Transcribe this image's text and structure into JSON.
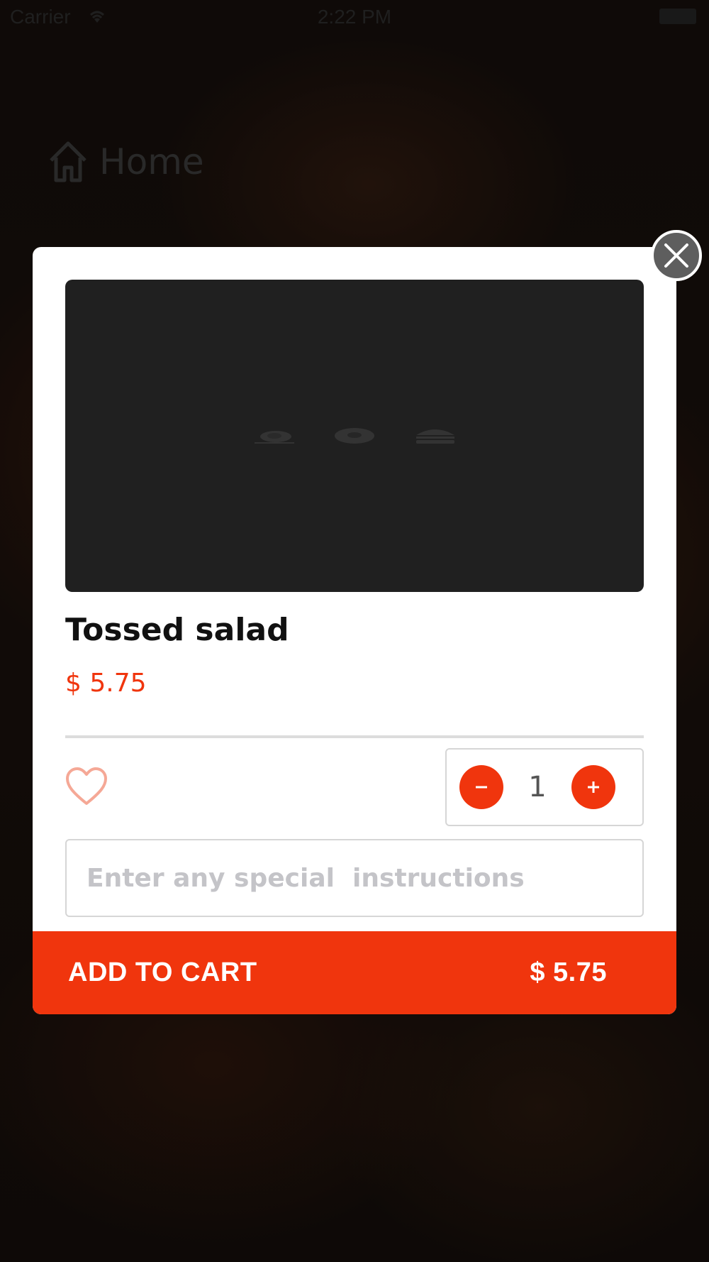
{
  "status_bar": {
    "carrier": "Carrier",
    "time": "2:22 PM"
  },
  "nav": {
    "home_label": "Home",
    "home_icon": "home-icon"
  },
  "modal": {
    "close_icon": "close-icon",
    "product": {
      "name": "Tossed salad",
      "price": "$ 5.75",
      "image_icons": [
        "steak-icon",
        "donut-icon",
        "burger-icon"
      ]
    },
    "favorite_icon": "heart-outline-icon",
    "quantity": {
      "decrement_label": "−",
      "value": "1",
      "increment_label": "+"
    },
    "instructions": {
      "placeholder": "Enter any special  instructions",
      "value": ""
    },
    "add_to_cart": {
      "label": "ADD TO CART",
      "total": "$ 5.75"
    }
  },
  "colors": {
    "accent": "#f0350d",
    "modal_bg": "#ffffff",
    "image_bg": "#202020"
  }
}
